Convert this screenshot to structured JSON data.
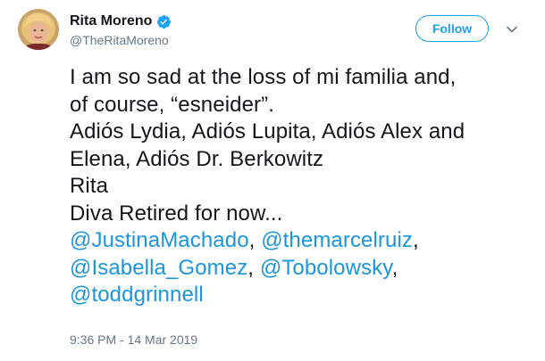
{
  "author": {
    "display_name": "Rita Moreno",
    "handle": "@TheRitaMoreno",
    "verified": true,
    "avatar_icon": "profile-photo"
  },
  "actions": {
    "follow_label": "Follow",
    "menu_icon": "chevron-down-icon"
  },
  "tweet": {
    "lines": [
      "I am so sad at the loss of mi familia and,",
      "of course, “esneider”.",
      "Adiós Lydia, Adiós Lupita, Adiós Alex and",
      "Elena, Adiós Dr. Berkowitz",
      "Rita",
      "Diva Retired for now..."
    ],
    "mentions": [
      "@JustinaMachado",
      "@themarcelruiz",
      "@Isabella_Gomez",
      "@Tobolowsky",
      "@toddgrinnell"
    ],
    "separators": [
      ", ",
      ",",
      ", ",
      ","
    ],
    "timestamp": "9:36 PM - 14 Mar 2019"
  },
  "colors": {
    "link": "#1b95e0",
    "accent": "#1da1f2",
    "secondary_text": "#657786",
    "primary_text": "#14171a"
  }
}
